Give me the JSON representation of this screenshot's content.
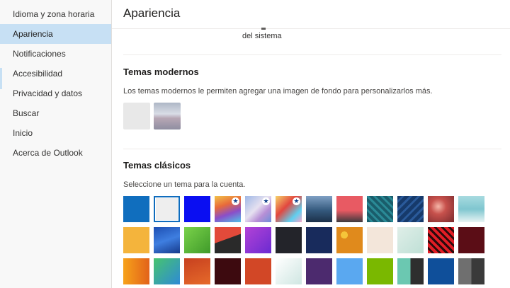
{
  "sidebar": {
    "items": [
      {
        "label": "Idioma y zona horaria",
        "selected": false
      },
      {
        "label": "Apariencia",
        "selected": true
      },
      {
        "label": "Notificaciones",
        "selected": false
      },
      {
        "label": "Accesibilidad",
        "selected": false
      },
      {
        "label": "Privacidad y datos",
        "selected": false
      },
      {
        "label": "Buscar",
        "selected": false
      },
      {
        "label": "Inicio",
        "selected": false
      },
      {
        "label": "Acerca de Outlook",
        "selected": false
      }
    ]
  },
  "main": {
    "title": "Apariencia",
    "partial_text": "del sistema",
    "modern": {
      "title": "Temas modernos",
      "description": "Los temas modernos le permiten agregar una imagen de fondo para personalizarlos más."
    },
    "classic": {
      "title": "Temas clásicos",
      "description": "Seleccione un tema para la cuenta.",
      "selected_index": 1
    }
  },
  "colors": {
    "selected_nav": "#c7e0f4",
    "selection_border": "#0f6cbd"
  }
}
